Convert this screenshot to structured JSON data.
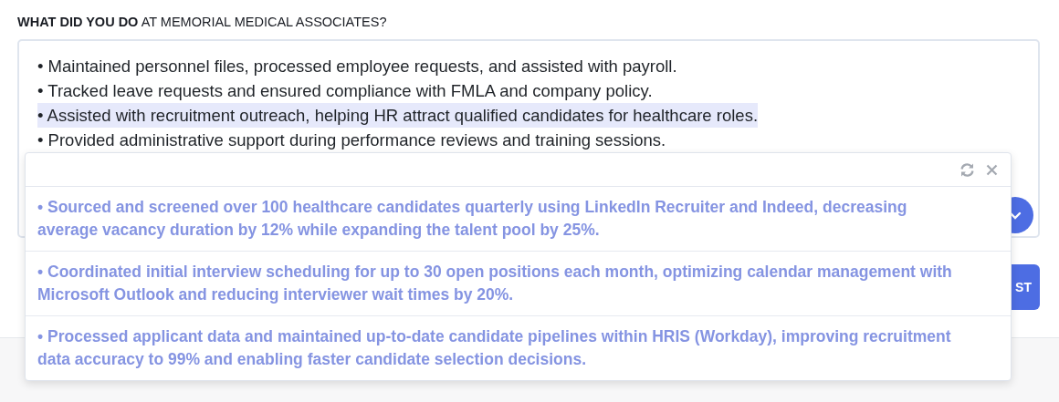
{
  "question": {
    "strong": "WHAT DID YOU DO",
    "rest": "AT MEMORIAL MEDICAL ASSOCIATES?"
  },
  "editor": {
    "lines": [
      {
        "text": "• Maintained personnel files, processed employee requests, and assisted with payroll.",
        "selected": false
      },
      {
        "text": "• Tracked leave requests and ensured compliance with FMLA and company policy.",
        "selected": false
      },
      {
        "text": "• Assisted with recruitment outreach, helping HR attract qualified candidates for healthcare roles.",
        "selected": true
      },
      {
        "text": "• Provided administrative support during performance reviews and training sessions.",
        "selected": false
      }
    ]
  },
  "submit_button": {
    "label": "ST"
  },
  "suggestions": [
    {
      "text": "• Sourced and screened over 100 healthcare candidates quarterly using LinkedIn Recruiter and Indeed, decreasing average vacancy duration by 12% while expanding the talent pool by 25%."
    },
    {
      "text": "• Coordinated initial interview scheduling for up to 30 open positions each month, optimizing calendar management with Microsoft Outlook and reducing interviewer wait times by 20%."
    },
    {
      "text": "• Processed applicant data and maintained up-to-date candidate pipelines within HRIS (Workday), improving recruitment data accuracy to 99% and enabling faster candidate selection decisions."
    }
  ]
}
